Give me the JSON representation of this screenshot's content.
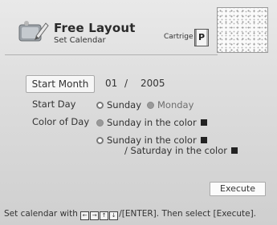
{
  "header": {
    "title": "Free Layout",
    "subtitle": "Set Calendar",
    "cartridge_label": "Cartrige",
    "cartridge_type": "P"
  },
  "form": {
    "start_month": {
      "label": "Start Month",
      "month": "01",
      "separator": "/",
      "year": "2005"
    },
    "start_day": {
      "label": "Start Day",
      "options": [
        {
          "label": "Sunday",
          "selected": true
        },
        {
          "label": "Monday",
          "selected": false
        }
      ]
    },
    "color_of_day": {
      "label": "Color of Day",
      "options": [
        {
          "label": "Sunday in the color",
          "selected": false
        },
        {
          "label": "Sunday in the color",
          "line2": "/ Saturday in the color",
          "selected": true
        }
      ]
    }
  },
  "execute_label": "Execute",
  "help": {
    "prefix": "Set calendar with",
    "keys": [
      "←",
      "→",
      "↑",
      "↓"
    ],
    "suffix": "/[ENTER]. Then select [Execute]."
  }
}
